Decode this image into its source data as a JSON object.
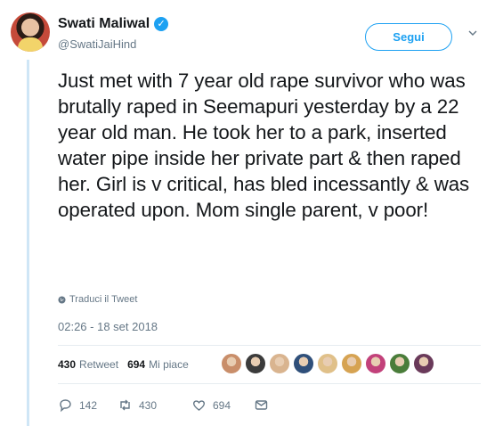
{
  "author": {
    "name": "Swati Maliwal",
    "handle": "@SwatiJaiHind",
    "follow_label": "Segui"
  },
  "tweet": {
    "text": "Just met with 7 year old rape survivor who was brutally raped in Seemapuri yesterday by a 22 year old man. He took her to a park, inserted water pipe inside her private part & then raped her. Girl is v critical, has bled incessantly & was operated upon. Mom single parent, v poor!",
    "translate_label": "Traduci il Tweet",
    "timestamp": "02:26 - 18 set 2018"
  },
  "stats": {
    "retweet_count": "430",
    "retweet_label": "Retweet",
    "like_count": "694",
    "like_label": "Mi piace"
  },
  "liker_avatars": [
    {
      "icon": "avatar-1",
      "color": "#c98e6a"
    },
    {
      "icon": "avatar-2",
      "color": "#3b3b3b"
    },
    {
      "icon": "avatar-3",
      "color": "#d9b48f"
    },
    {
      "icon": "avatar-4",
      "color": "#2f4f7a"
    },
    {
      "icon": "avatar-5",
      "color": "#e0c089"
    },
    {
      "icon": "avatar-6",
      "color": "#d6a352"
    },
    {
      "icon": "avatar-7",
      "color": "#c2417a"
    },
    {
      "icon": "avatar-8",
      "color": "#4a7d3a"
    },
    {
      "icon": "avatar-9",
      "color": "#6a3a5a"
    }
  ],
  "actions": {
    "reply_count": "142",
    "retweet_count": "430",
    "like_count": "694"
  },
  "colors": {
    "accent": "#1da1f2",
    "secondary_text": "#657786",
    "thread_line": "#cfe6f6"
  }
}
